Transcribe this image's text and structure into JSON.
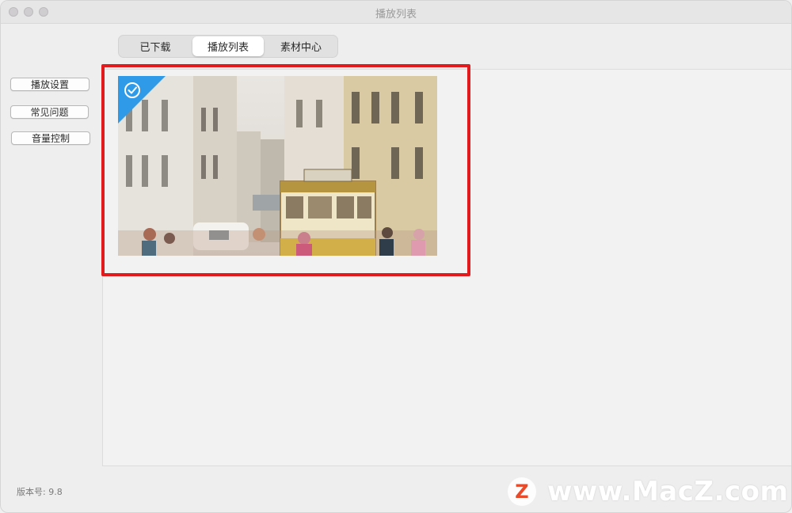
{
  "window": {
    "title": "播放列表"
  },
  "tabs": [
    {
      "label": "已下载",
      "active": false
    },
    {
      "label": "播放列表",
      "active": true
    },
    {
      "label": "素材中心",
      "active": false
    }
  ],
  "sidebar": {
    "buttons": [
      {
        "label": "播放设置"
      },
      {
        "label": "常见问题"
      },
      {
        "label": "音量控制"
      }
    ]
  },
  "playlist": {
    "items": [
      {
        "selected": true,
        "icon": "check-circle-icon"
      }
    ]
  },
  "footer": {
    "version": "版本号: 9.8"
  },
  "watermark": {
    "logo": "Z",
    "text": "www.MacZ.com"
  },
  "colors": {
    "highlight": "#e21a1e",
    "selected_corner": "#2f9be8",
    "window_bg": "#efeeef"
  }
}
